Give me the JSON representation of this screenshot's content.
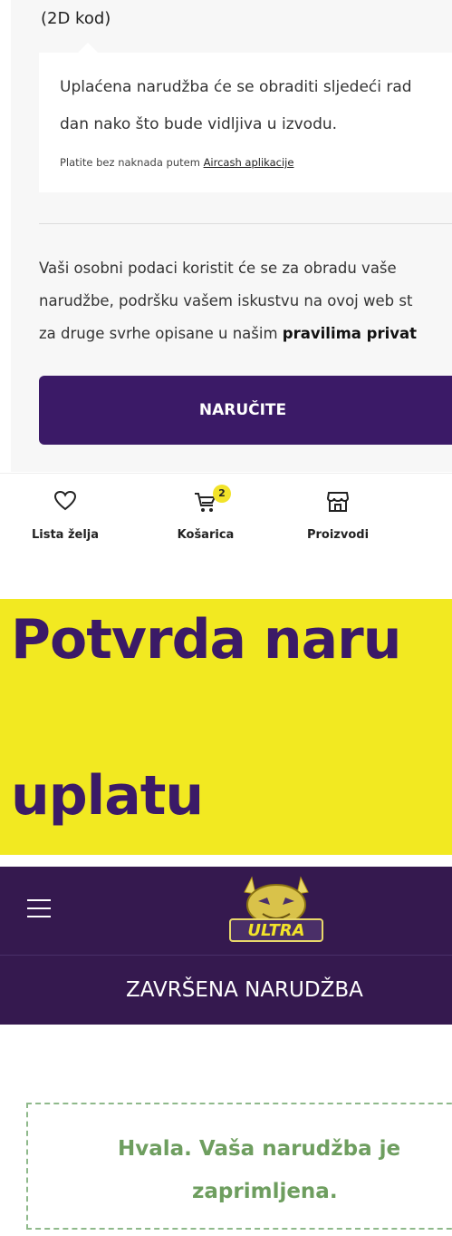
{
  "checkout": {
    "top_label": "(2D kod)",
    "info": {
      "line1": "Uplaćena narudžba će se obraditi sljedeći rad",
      "line2": "dan nako što bude vidljiva u izvodu.",
      "aircash_prefix": "Platite bez naknada putem ",
      "aircash_link": "Aircash aplikacije"
    },
    "privacy": {
      "line1": "Vaši osobni podaci koristit će se za obradu vaše",
      "line2": "narudžbe, podršku vašem iskustvu na ovoj web st",
      "line3_prefix": "za druge svrhe opisane u našim ",
      "line3_bold": "pravilima privat"
    },
    "order_button": "NARUČITE"
  },
  "bottom_nav": {
    "items": [
      {
        "label": "Lista želja",
        "icon": "heart-icon"
      },
      {
        "label": "Košarica",
        "icon": "cart-icon",
        "badge": "2"
      },
      {
        "label": "Proizvodi",
        "icon": "store-icon"
      }
    ]
  },
  "heading": {
    "line1": "Potvrda naru",
    "line2": "uplatu"
  },
  "site": {
    "logo_text": "ULTRA",
    "page_title": "ZAVRŠENA NARUDŽBA",
    "notice_line1": "Hvala. Vaša narudžba je",
    "notice_line2": "zaprimljena."
  },
  "colors": {
    "brand_purple": "#3b1a67",
    "header_purple": "#35194f",
    "highlight_yellow": "#f2e921",
    "success_green": "#6e9e5f"
  }
}
